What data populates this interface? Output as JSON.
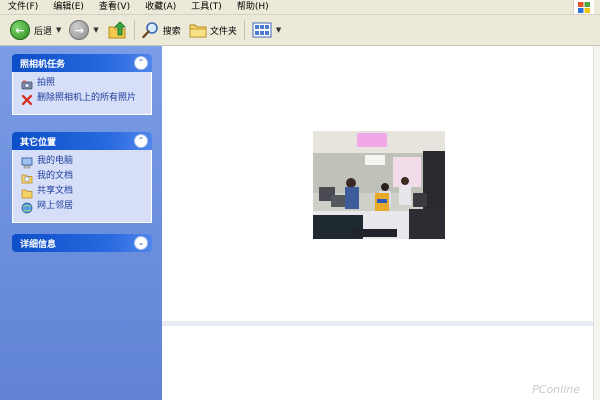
{
  "menu": [
    "文件(F)",
    "编辑(E)",
    "查看(V)",
    "收藏(A)",
    "工具(T)",
    "帮助(H)"
  ],
  "toolbar": {
    "back_label": "后退",
    "search_label": "搜索",
    "folders_label": "文件夹"
  },
  "taskpane": {
    "camera_tasks": {
      "title": "照相机任务",
      "items": [
        {
          "label": "拍照",
          "icon": "camera-icon"
        },
        {
          "label": "删除照相机上的所有照片",
          "icon": "delete-x-icon"
        }
      ]
    },
    "other_places": {
      "title": "其它位置",
      "items": [
        {
          "label": "我的电脑",
          "icon": "my-computer-icon"
        },
        {
          "label": "我的文档",
          "icon": "my-documents-icon"
        },
        {
          "label": "共享文档",
          "icon": "shared-folder-icon"
        },
        {
          "label": "网上邻居",
          "icon": "network-places-icon"
        }
      ]
    },
    "details": {
      "title": "详细信息"
    }
  },
  "watermark": "PConline",
  "colors": {
    "taskpane_bg": "#7b9de6",
    "panel_header": "#0c4ec8",
    "panel_body": "#d6dff7",
    "link": "#1c3c9c",
    "chrome": "#ece9d8"
  }
}
